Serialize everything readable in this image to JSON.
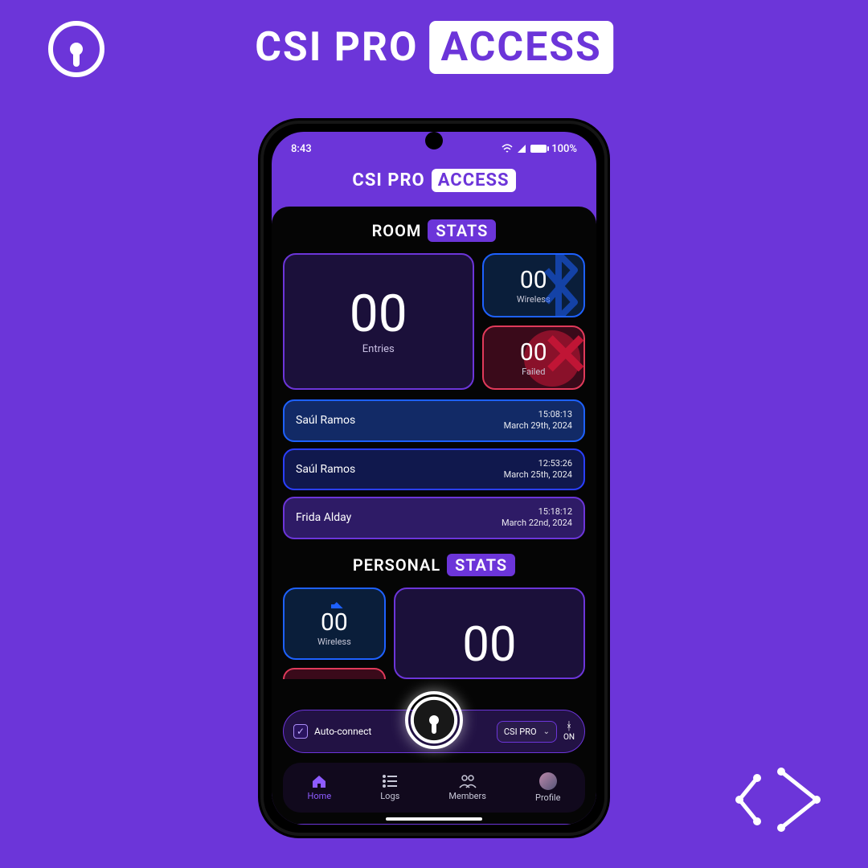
{
  "promo": {
    "brand_pre": "CSI PRO",
    "brand_chip": "ACCESS"
  },
  "statusbar": {
    "time": "8:43",
    "battery": "100%"
  },
  "appHeader": {
    "pre": "CSI PRO",
    "chip": "ACCESS"
  },
  "roomStats": {
    "title_pre": "ROOM",
    "title_chip": "STATS",
    "entries": {
      "value": "00",
      "label": "Entries"
    },
    "wireless": {
      "value": "00",
      "label": "Wireless"
    },
    "failed": {
      "value": "00",
      "label": "Failed"
    }
  },
  "logs": [
    {
      "name": "Saúl Ramos",
      "time": "15:08:13",
      "date": "March 29th, 2024",
      "style": "blue1"
    },
    {
      "name": "Saúl Ramos",
      "time": "12:53:26",
      "date": "March 25th, 2024",
      "style": "blue2"
    },
    {
      "name": "Frida Alday",
      "time": "15:18:12",
      "date": "March 22nd, 2024",
      "style": "purple"
    }
  ],
  "personalStats": {
    "title_pre": "PERSONAL",
    "title_chip": "STATS",
    "wireless": {
      "value": "00",
      "label": "Wireless"
    },
    "entries": {
      "value": "00"
    }
  },
  "controls": {
    "auto_connect_label": "Auto-connect",
    "auto_connect_checked": true,
    "room_name": "CSI PRO",
    "bt_status": "ON"
  },
  "nav": {
    "home": "Home",
    "logs": "Logs",
    "members": "Members",
    "profile": "Profile"
  },
  "icons": {
    "check": "✓",
    "chevron_down": "⌄",
    "bluetooth": "ᚼ"
  }
}
